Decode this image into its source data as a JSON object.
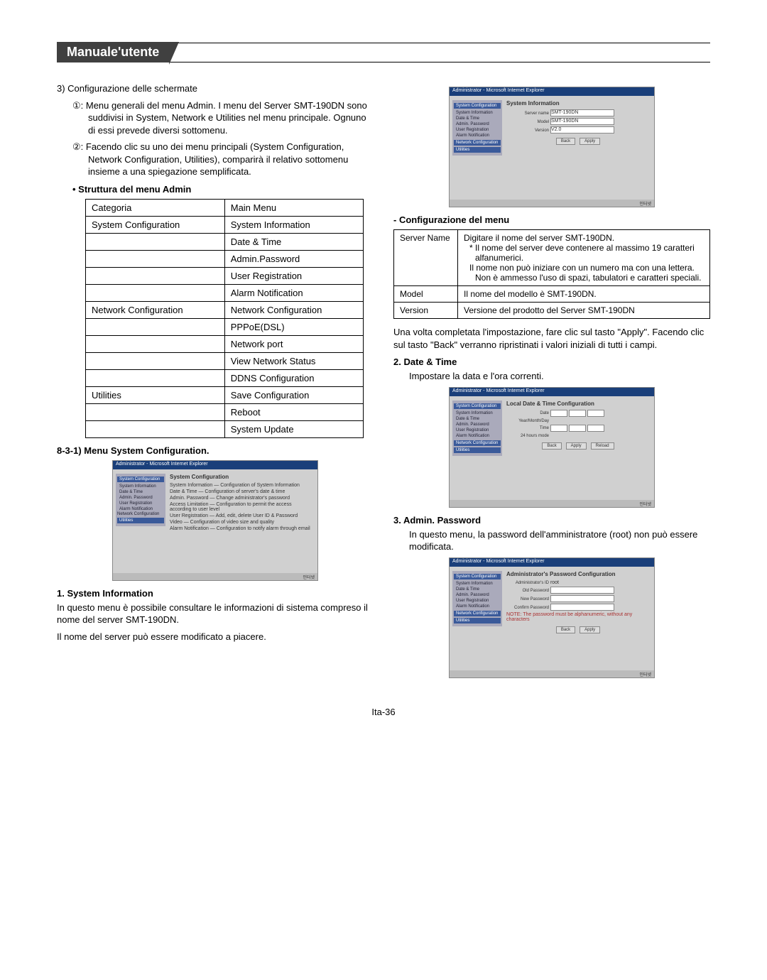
{
  "header": {
    "title": "Manuale'utente"
  },
  "left": {
    "step3": "3) Configurazione delle schermate",
    "step3_1": "①: Menu generali del menu Admin. I menu del Server SMT-190DN sono suddivisi in System, Network e Utilities nel menu principale. Ognuno di essi prevede diversi sottomenu.",
    "step3_2": "②: Facendo clic su uno dei menu principali (System Configuration, Network Configuration, Utilities), comparirà il relativo sottomenu insieme a una spiegazione semplificata.",
    "struct_title": "Struttura del menu Admin",
    "table": {
      "rows": [
        [
          "Categoria",
          "Main Menu"
        ],
        [
          "System Configuration",
          "System Information"
        ],
        [
          "",
          "Date & Time"
        ],
        [
          "",
          "Admin.Password"
        ],
        [
          "",
          "User Registration"
        ],
        [
          "",
          "Alarm Notification"
        ],
        [
          "Network Configuration",
          "Network Configuration"
        ],
        [
          "",
          "PPPoE(DSL)"
        ],
        [
          "",
          "Network port"
        ],
        [
          "",
          "View Network Status"
        ],
        [
          "",
          "DDNS Configuration"
        ],
        [
          "Utilities",
          "Save Configuration"
        ],
        [
          "",
          "Reboot"
        ],
        [
          "",
          "System Update"
        ]
      ]
    },
    "sec_831": "8-3-1) Menu System Configuration.",
    "sysinfo_title": "1. System Information",
    "sysinfo_p1": "In questo menu è possibile consultare le informazioni di sistema compreso il nome del server SMT-190DN.",
    "sysinfo_p2": "Il nome del server può essere modificato a piacere."
  },
  "right": {
    "config_title": "Configurazione del menu",
    "config_rows": [
      {
        "k": "Server Name",
        "v": "Digitare il nome del server SMT-190DN.",
        "bullets": [
          "Il nome del server deve contenere al massimo 19 caratteri alfanumerici.",
          "Il nome non può iniziare con un numero ma con una lettera. Non è ammesso l'uso di spazi, tabulatori e caratteri speciali."
        ]
      },
      {
        "k": "Model",
        "v": "Il nome del modello è SMT-190DN."
      },
      {
        "k": "Version",
        "v": "Versione del prodotto del Server SMT-190DN"
      }
    ],
    "apply_note": "Una volta completata l'impostazione, fare clic sul tasto \"Apply\". Facendo clic sul tasto \"Back\" verranno ripristinati i valori iniziali di tutti i campi.",
    "datetime_title": "2. Date & Time",
    "datetime_p": "Impostare la data e l'ora correnti.",
    "adminpw_title": "3. Admin. Password",
    "adminpw_p": "In questo menu, la password dell'amministratore (root) non può essere modificata."
  },
  "screenshots": {
    "titlebar_ie": "Administrator - Microsoft Internet Explorer",
    "side_sysconf": "System Configuration",
    "side_items": [
      "System Information",
      "Date & Time",
      "Admin. Password",
      "User Registration",
      "Alarm Notification"
    ],
    "side_netconf": "Network Configuration",
    "side_util": "Utilities",
    "shot1_title": "System Configuration",
    "shot1_rows": [
      [
        "System Information",
        "Configuration of System Information"
      ],
      [
        "Date & Time",
        "Configuration of server's date & time"
      ],
      [
        "Admin. Password",
        "Change administrator's password"
      ],
      [
        "Access Limitation",
        "Configuration to permit the access according to user level"
      ],
      [
        "User Registration",
        "Add, edit, delete User ID & Password"
      ],
      [
        "Video",
        "Configuration of video size and quality"
      ],
      [
        "Alarm Notification",
        "Configuration to notify alarm through email"
      ]
    ],
    "shot2_title": "System Information",
    "shot2_labels": [
      "Server name",
      "Model",
      "Version"
    ],
    "shot2_values": [
      "SMT-190DN",
      "SMT-190DN",
      "V2.0"
    ],
    "shot3_title": "Local Date & Time Configuration",
    "shot3_labels": [
      "Date",
      "Year/Month/Day",
      "Time",
      "24 hours mode"
    ],
    "shot4_title": "Administrator's Password Configuration",
    "shot4_labels": [
      "Administrator's ID",
      "Old Password",
      "New Password",
      "Confirm Password"
    ],
    "shot4_note": "NOTE: The password must be alphanumeric, without any characters",
    "btn_back": "Back",
    "btn_apply": "Apply",
    "btn_reload": "Reload",
    "status": "인터넷"
  },
  "footer": "Ita-36"
}
